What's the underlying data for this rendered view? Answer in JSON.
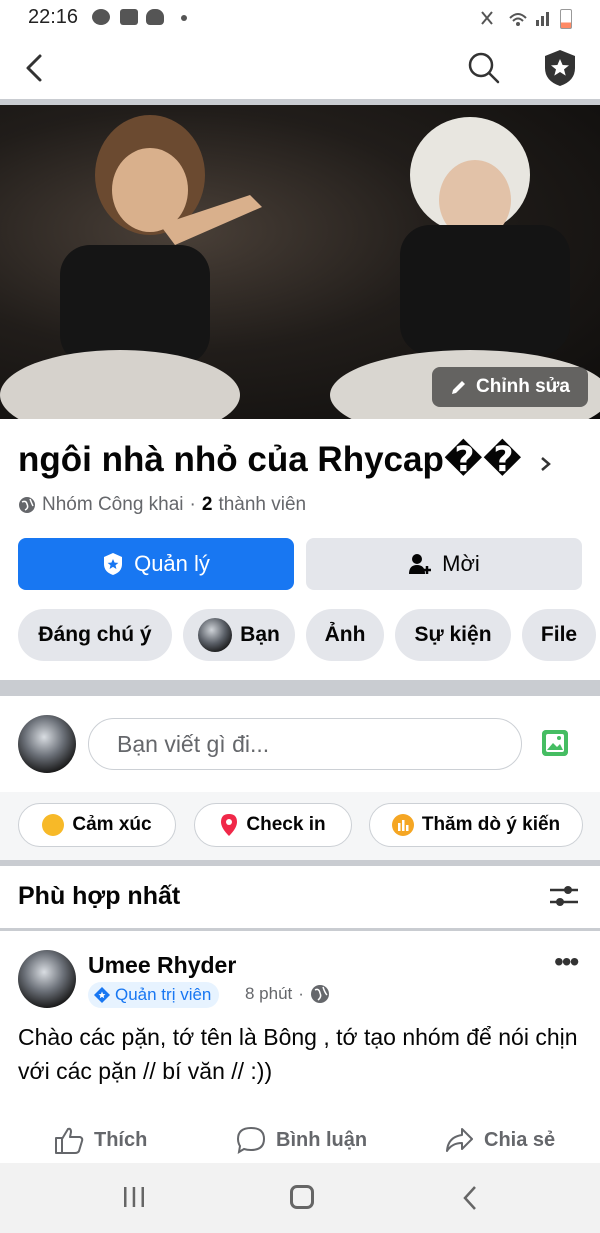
{
  "status_bar": {
    "time": "22:16"
  },
  "header": {
    "back_icon": "chevron-left-icon",
    "search_icon": "search-icon",
    "admin_icon": "shield-star-icon"
  },
  "cover": {
    "edit_label": "Chỉnh sửa"
  },
  "group": {
    "name": "ngôi nhà nhỏ của Rhycap��",
    "privacy": "Nhóm Công khai",
    "separator": "·",
    "member_count": "2",
    "member_label": "thành viên"
  },
  "actions": {
    "manage_label": "Quản lý",
    "invite_label": "Mời"
  },
  "tabs": [
    {
      "label": "Đáng chú ý"
    },
    {
      "label": "Bạn"
    },
    {
      "label": "Ảnh"
    },
    {
      "label": "Sự kiện"
    },
    {
      "label": "File"
    }
  ],
  "composer": {
    "placeholder": "Bạn viết gì đi..."
  },
  "composer_actions": [
    {
      "label": "Cảm xúc",
      "color": "#f7b928"
    },
    {
      "label": "Check in",
      "color": "#f02849"
    },
    {
      "label": "Thăm dò ý kiến",
      "color": "#f5a623"
    }
  ],
  "feed": {
    "sort_label": "Phù hợp nhất"
  },
  "post": {
    "author": "Umee Rhyder",
    "role": "Quản trị viên",
    "time": "8 phút",
    "separator": "·",
    "text": "Chào các pặn, tớ tên là Bông , tớ tạo nhóm để nói chịn với các pặn // bí văn // :))",
    "like_label": "Thích",
    "comment_label": "Bình luận",
    "share_label": "Chia sẻ"
  },
  "colors": {
    "primary": "#1877f2",
    "secondary_button": "#e4e6eb",
    "text_secondary": "#65676b"
  }
}
